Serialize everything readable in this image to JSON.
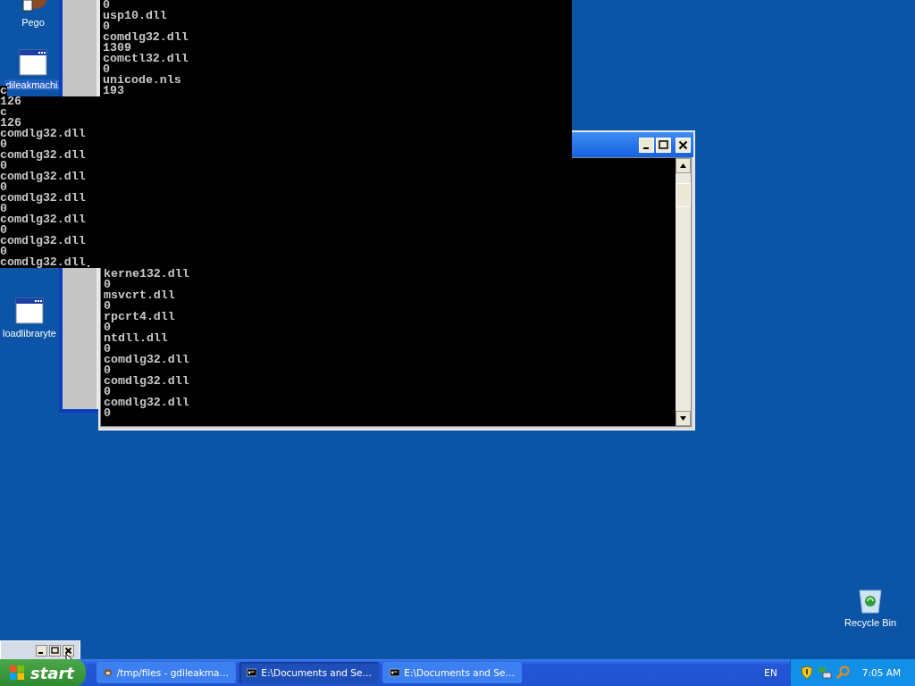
{
  "desktop_icons": [
    {
      "kind": "app",
      "label": "Pego"
    },
    {
      "kind": "window",
      "label": "dileakmachi."
    },
    {
      "kind": "window",
      "label": "loadlibraryte"
    },
    {
      "kind": "recycle",
      "label": "Recycle Bin"
    }
  ],
  "back_console": {
    "lines": [
      "0",
      "usp10.dll",
      "0",
      "comdlg32.dll",
      "1309",
      "comctl32.dll",
      "0",
      "unicode.nls",
      "193"
    ]
  },
  "left_console": {
    "lines": [
      "c",
      "126",
      "c",
      "126",
      "comdlg32.dll",
      "0",
      "comdlg32.dll",
      "0",
      "comdlg32.dll",
      "0",
      "comdlg32.dll",
      "0",
      "comdlg32.dll",
      "0",
      "comdlg32.dll",
      "0",
      "comdlg32.dll"
    ]
  },
  "front_console": {
    "lines": [
      "kerne132.dll",
      "0",
      "msvcrt.dll",
      "0",
      "rpcrt4.dll",
      "0",
      "ntdll.dll",
      "0",
      "comdlg32.dll",
      "0",
      "comdlg32.dll",
      "0",
      "comdlg32.dll",
      "0"
    ]
  },
  "taskbar": {
    "start": "start",
    "tasks": [
      {
        "kind": "explorer",
        "label": "/tmp/files - gdileakma…",
        "selected": false
      },
      {
        "kind": "console",
        "label": "E:\\Documents and Se…",
        "selected": true
      },
      {
        "kind": "console",
        "label": "E:\\Documents and Se…",
        "selected": false
      }
    ],
    "language": "EN",
    "clock": "7:05 AM"
  }
}
